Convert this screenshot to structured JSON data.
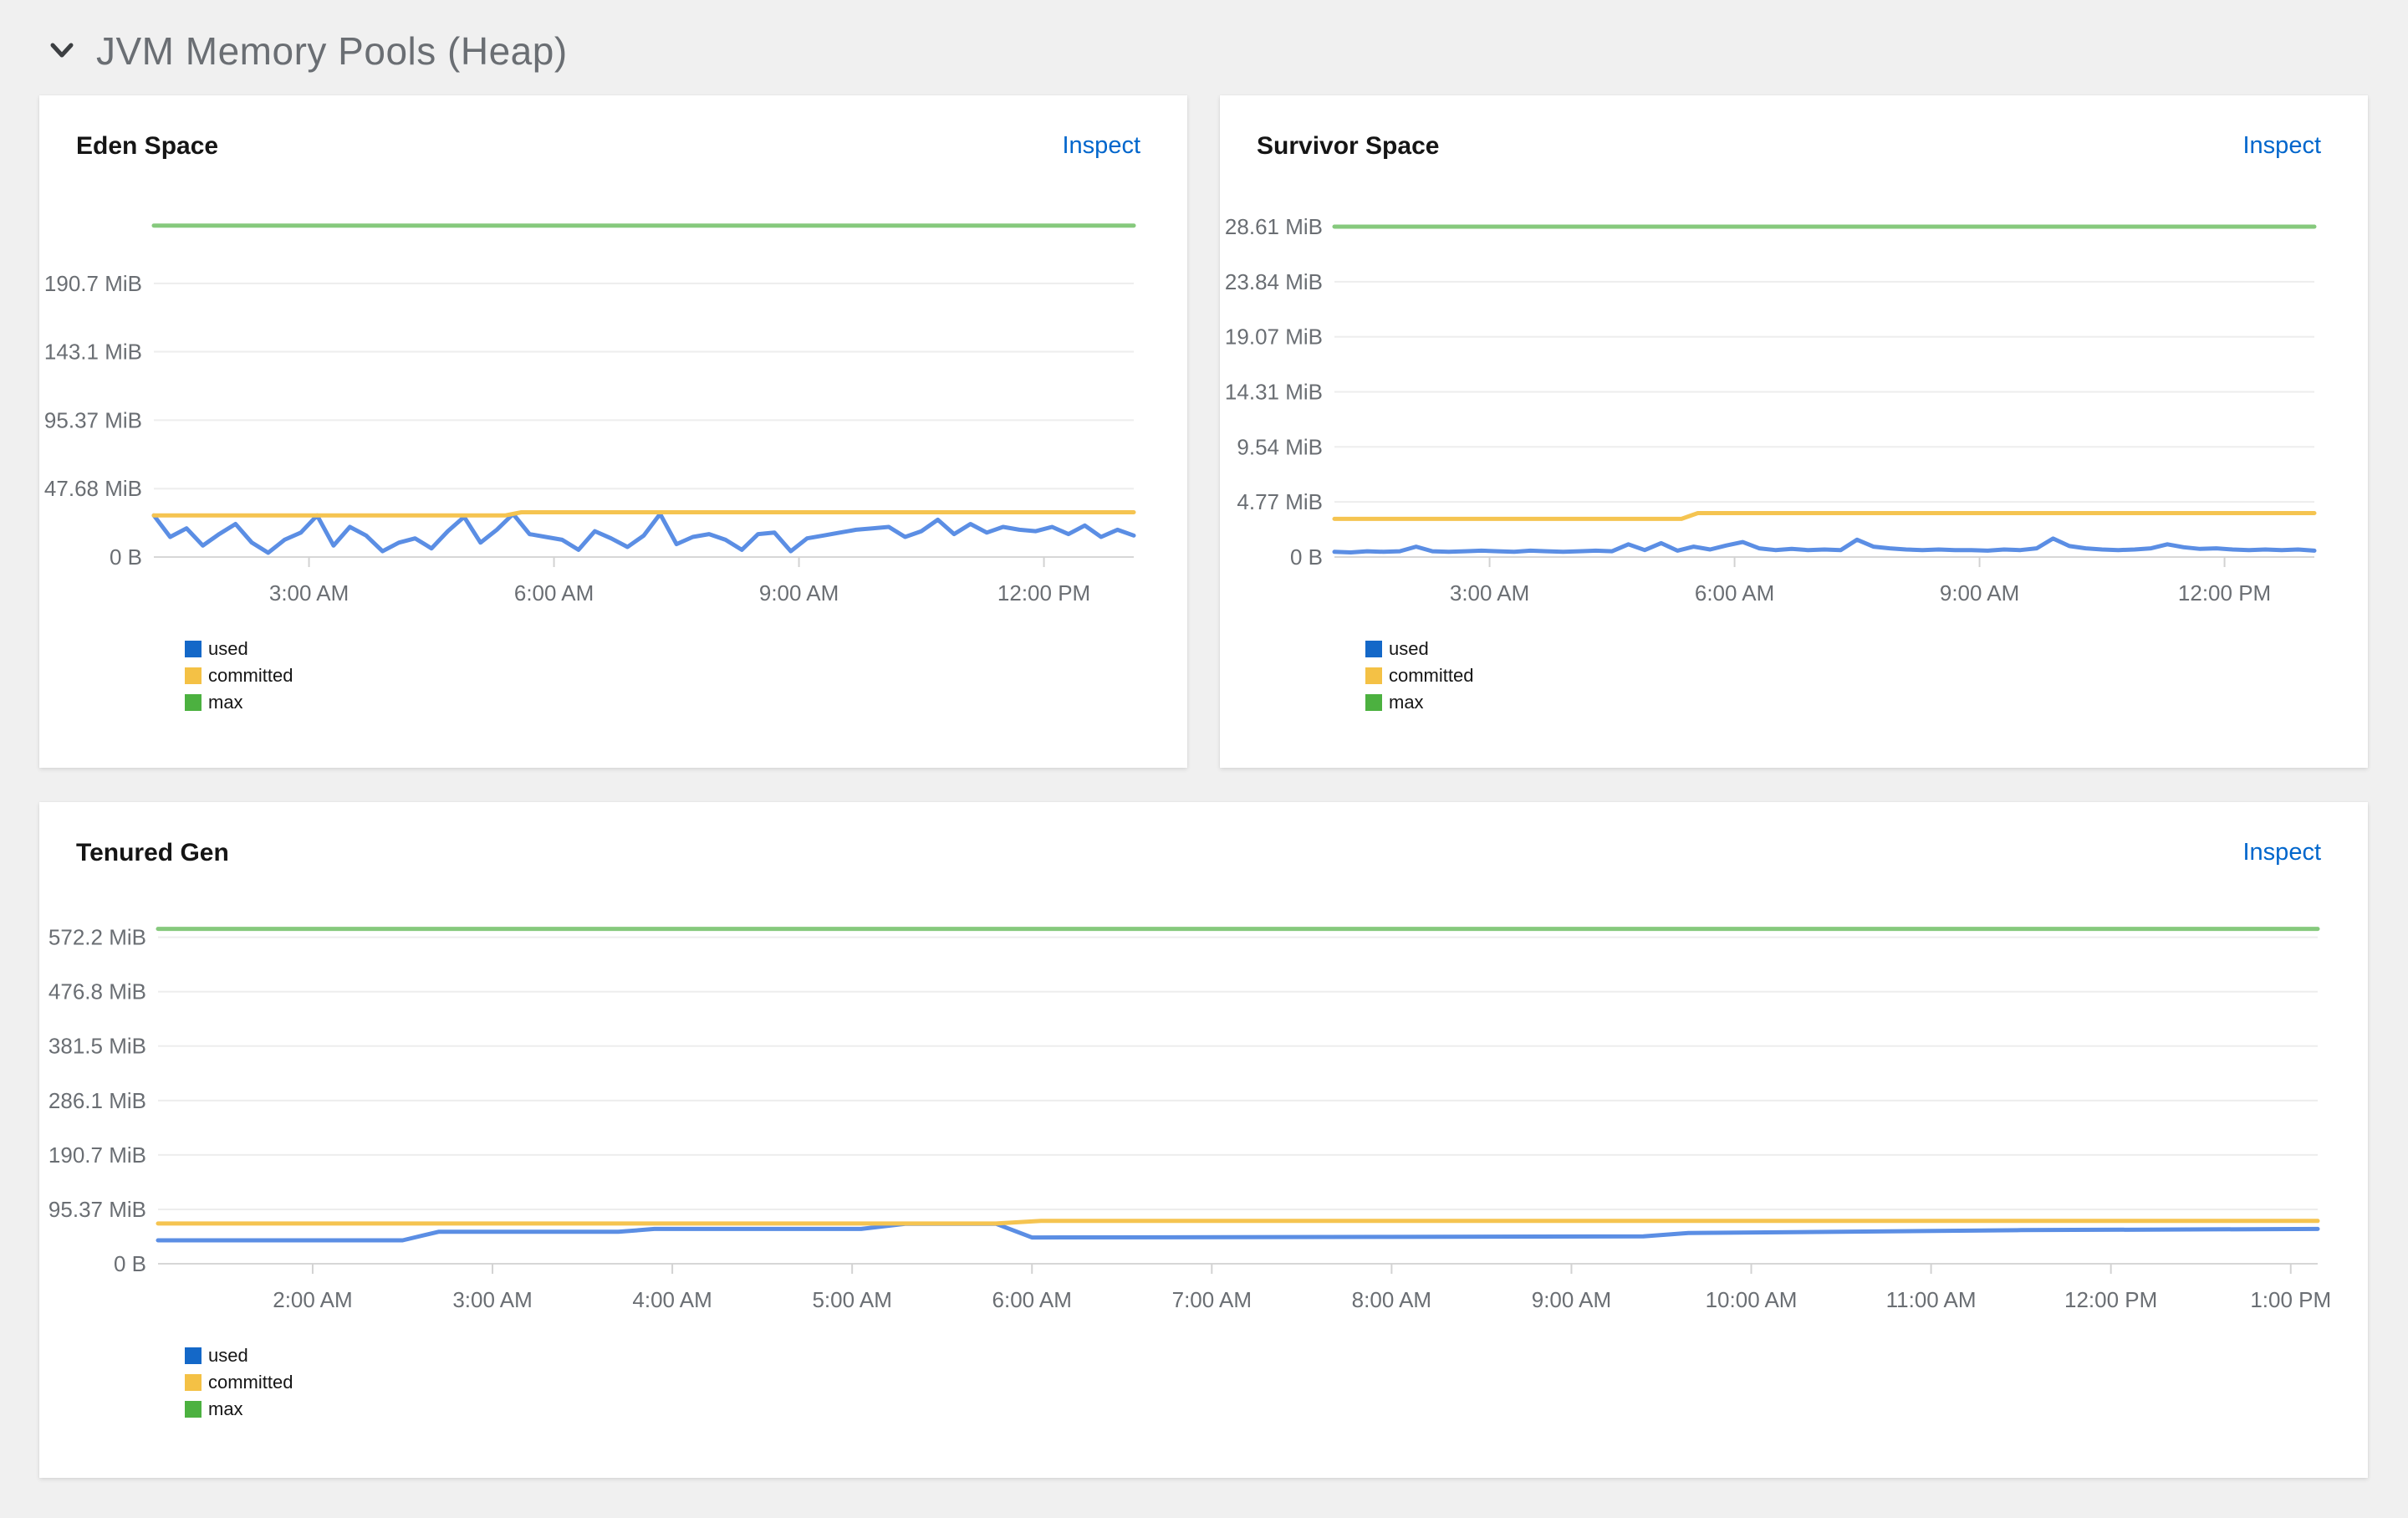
{
  "colors": {
    "background": "#f0f0f0",
    "card": "#ffffff",
    "link": "#0066cc",
    "axis_text": "#6a6e73",
    "grid": "#ededed",
    "axis_line": "#d7d7d7",
    "panel_title": "#151515",
    "section_title": "#6a6e73"
  },
  "section": {
    "title": "JVM Memory Pools (Heap)",
    "collapse_icon": "chevron-down-icon",
    "expanded": true
  },
  "panels": [
    {
      "title": "Eden Space",
      "inspect_label": "Inspect",
      "legend": [
        {
          "label": "used",
          "color": "#1468c8"
        },
        {
          "label": "committed",
          "color": "#f4c145"
        },
        {
          "label": "max",
          "color": "#4cb140"
        }
      ],
      "chart_data": {
        "type": "line",
        "unit": "MiB",
        "xlim": [
          1.1,
          13.1
        ],
        "ylim": [
          0,
          239
        ],
        "grid": "horizontal",
        "legend_position": "bottom-left",
        "yticks": [
          {
            "v": 0,
            "label": "0 B"
          },
          {
            "v": 47.68,
            "label": "47.68 MiB"
          },
          {
            "v": 95.37,
            "label": "95.37 MiB"
          },
          {
            "v": 143.1,
            "label": "143.1 MiB"
          },
          {
            "v": 190.7,
            "label": "190.7 MiB"
          }
        ],
        "xticks": [
          {
            "v": 3,
            "label": "3:00 AM"
          },
          {
            "v": 6,
            "label": "6:00 AM"
          },
          {
            "v": 9,
            "label": "9:00 AM"
          },
          {
            "v": 12,
            "label": "12:00 PM"
          }
        ],
        "series": [
          {
            "name": "used",
            "line_color": "#5b8ee4",
            "x_start": 1.1,
            "x_step": 0.2,
            "values": [
              29,
              14,
              20,
              8,
              16,
              23,
              10,
              3,
              12,
              17,
              29,
              8,
              21,
              15,
              4,
              10,
              13,
              6,
              18,
              28,
              10,
              19,
              30,
              16,
              14,
              12,
              5,
              18,
              13,
              7,
              15,
              30,
              9,
              14,
              16,
              12,
              5,
              16,
              17,
              4,
              13,
              15,
              17,
              19,
              20,
              21,
              14,
              18,
              26,
              16,
              23,
              17,
              21,
              19,
              18,
              21,
              16,
              22,
              14,
              19,
              15
            ]
          },
          {
            "name": "committed",
            "line_color": "#f5c451",
            "points": [
              [
                1.1,
                29
              ],
              [
                5.4,
                29
              ],
              [
                5.6,
                31.2
              ],
              [
                13.1,
                31.2
              ]
            ]
          },
          {
            "name": "max",
            "line_color": "#86c97d",
            "points": [
              [
                1.1,
                231
              ],
              [
                13.1,
                231
              ]
            ]
          }
        ]
      }
    },
    {
      "title": "Survivor Space",
      "inspect_label": "Inspect",
      "legend": [
        {
          "label": "used",
          "color": "#1468c8"
        },
        {
          "label": "committed",
          "color": "#f4c145"
        },
        {
          "label": "max",
          "color": "#4cb140"
        }
      ],
      "chart_data": {
        "type": "line",
        "unit": "MiB",
        "xlim": [
          1.1,
          13.1
        ],
        "ylim": [
          0,
          29.7
        ],
        "grid": "horizontal",
        "legend_position": "bottom-left",
        "yticks": [
          {
            "v": 0,
            "label": "0 B"
          },
          {
            "v": 4.77,
            "label": "4.77 MiB"
          },
          {
            "v": 9.54,
            "label": "9.54 MiB"
          },
          {
            "v": 14.31,
            "label": "14.31 MiB"
          },
          {
            "v": 19.07,
            "label": "19.07 MiB"
          },
          {
            "v": 23.84,
            "label": "23.84 MiB"
          },
          {
            "v": 28.61,
            "label": "28.61 MiB"
          }
        ],
        "xticks": [
          {
            "v": 3,
            "label": "3:00 AM"
          },
          {
            "v": 6,
            "label": "6:00 AM"
          },
          {
            "v": 9,
            "label": "9:00 AM"
          },
          {
            "v": 12,
            "label": "12:00 PM"
          }
        ],
        "series": [
          {
            "name": "used",
            "line_color": "#5b8ee4",
            "x_start": 1.1,
            "x_step": 0.2,
            "values": [
              0.45,
              0.4,
              0.5,
              0.45,
              0.5,
              0.9,
              0.5,
              0.45,
              0.5,
              0.55,
              0.5,
              0.45,
              0.55,
              0.5,
              0.45,
              0.5,
              0.55,
              0.5,
              1.1,
              0.6,
              1.2,
              0.55,
              0.9,
              0.65,
              1.0,
              1.3,
              0.75,
              0.6,
              0.7,
              0.6,
              0.65,
              0.6,
              1.5,
              0.9,
              0.75,
              0.65,
              0.6,
              0.65,
              0.6,
              0.6,
              0.55,
              0.65,
              0.6,
              0.75,
              1.6,
              0.95,
              0.75,
              0.65,
              0.6,
              0.65,
              0.75,
              1.1,
              0.85,
              0.7,
              0.75,
              0.65,
              0.6,
              0.65,
              0.6,
              0.65,
              0.55
            ]
          },
          {
            "name": "committed",
            "line_color": "#f5c451",
            "points": [
              [
                1.1,
                3.3
              ],
              [
                5.35,
                3.3
              ],
              [
                5.55,
                3.8
              ],
              [
                13.1,
                3.8
              ]
            ]
          },
          {
            "name": "max",
            "line_color": "#86c97d",
            "points": [
              [
                1.1,
                28.61
              ],
              [
                13.1,
                28.61
              ]
            ]
          }
        ]
      }
    },
    {
      "title": "Tenured Gen",
      "inspect_label": "Inspect",
      "legend": [
        {
          "label": "used",
          "color": "#1468c8"
        },
        {
          "label": "committed",
          "color": "#f4c145"
        },
        {
          "label": "max",
          "color": "#4cb140"
        }
      ],
      "chart_data": {
        "type": "line",
        "unit": "MiB",
        "xlim": [
          1.14,
          13.15
        ],
        "ylim": [
          0,
          601
        ],
        "grid": "horizontal",
        "legend_position": "bottom-left",
        "yticks": [
          {
            "v": 0,
            "label": "0 B"
          },
          {
            "v": 95.37,
            "label": "95.37 MiB"
          },
          {
            "v": 190.7,
            "label": "190.7 MiB"
          },
          {
            "v": 286.1,
            "label": "286.1 MiB"
          },
          {
            "v": 381.5,
            "label": "381.5 MiB"
          },
          {
            "v": 476.8,
            "label": "476.8 MiB"
          },
          {
            "v": 572.2,
            "label": "572.2 MiB"
          }
        ],
        "xticks": [
          {
            "v": 2,
            "label": "2:00 AM"
          },
          {
            "v": 3,
            "label": "3:00 AM"
          },
          {
            "v": 4,
            "label": "4:00 AM"
          },
          {
            "v": 5,
            "label": "5:00 AM"
          },
          {
            "v": 6,
            "label": "6:00 AM"
          },
          {
            "v": 7,
            "label": "7:00 AM"
          },
          {
            "v": 8,
            "label": "8:00 AM"
          },
          {
            "v": 9,
            "label": "9:00 AM"
          },
          {
            "v": 10,
            "label": "10:00 AM"
          },
          {
            "v": 11,
            "label": "11:00 AM"
          },
          {
            "v": 12,
            "label": "12:00 PM"
          },
          {
            "v": 13,
            "label": "1:00 PM"
          }
        ],
        "series": [
          {
            "name": "used",
            "line_color": "#5b8ee4",
            "points": [
              [
                1.14,
                41
              ],
              [
                2.5,
                41
              ],
              [
                2.7,
                56
              ],
              [
                3.7,
                56
              ],
              [
                3.9,
                61
              ],
              [
                5.05,
                61
              ],
              [
                5.3,
                70
              ],
              [
                5.8,
                70
              ],
              [
                6.0,
                46
              ],
              [
                8.0,
                47
              ],
              [
                9.4,
                48
              ],
              [
                9.65,
                54
              ],
              [
                10.5,
                56
              ],
              [
                11.5,
                59
              ],
              [
                13.15,
                61
              ]
            ]
          },
          {
            "name": "committed",
            "line_color": "#f5c451",
            "points": [
              [
                1.14,
                70.5
              ],
              [
                5.8,
                70.5
              ],
              [
                6.05,
                75
              ],
              [
                13.15,
                75
              ]
            ]
          },
          {
            "name": "max",
            "line_color": "#86c97d",
            "points": [
              [
                1.14,
                587
              ],
              [
                13.15,
                587
              ]
            ]
          }
        ]
      }
    }
  ]
}
